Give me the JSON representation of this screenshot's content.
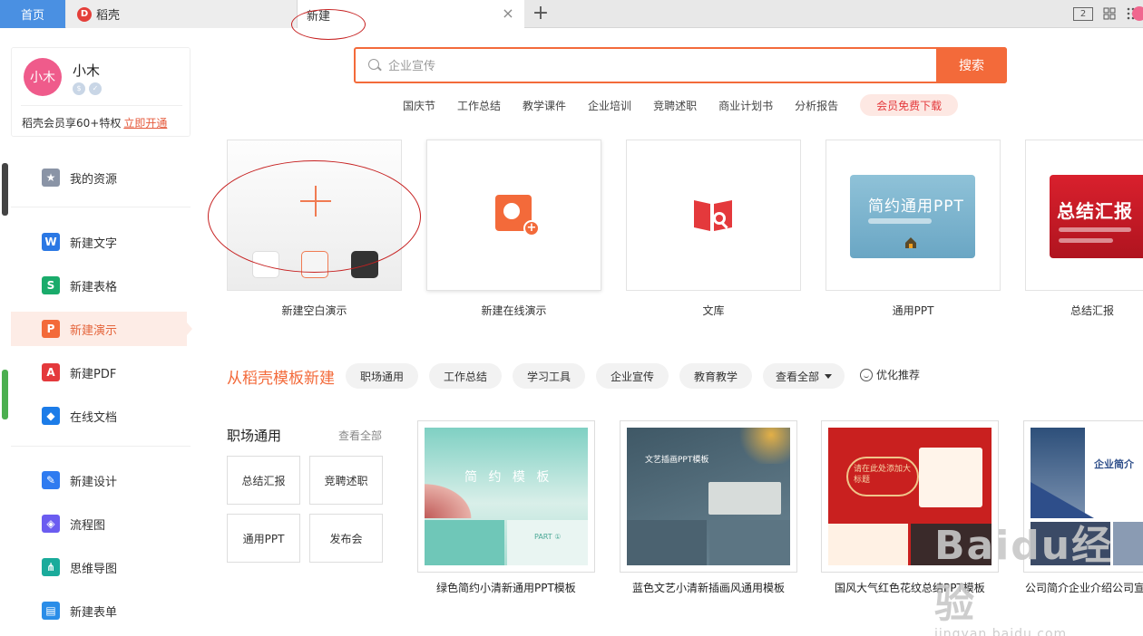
{
  "tabs": {
    "home": "首页",
    "daoke": "稻壳",
    "daoke_logo": "D",
    "new_tab": "新建",
    "close": "×",
    "add": "+",
    "window_badge": "2"
  },
  "user": {
    "avatar_text": "小木",
    "name": "小木",
    "vip_text": "稻壳会员享60+特权",
    "vip_link": "立即开通"
  },
  "sidebar": {
    "items": [
      {
        "label": "我的资源",
        "icon": "star-icon",
        "color": "#8a94a6"
      },
      {
        "label": "新建文字",
        "icon": "w-icon",
        "color": "#2b78e4"
      },
      {
        "label": "新建表格",
        "icon": "s-icon",
        "color": "#1aab6b"
      },
      {
        "label": "新建演示",
        "icon": "p-icon",
        "color": "#f36a3a"
      },
      {
        "label": "新建PDF",
        "icon": "pdf-icon",
        "color": "#e4393c"
      },
      {
        "label": "在线文档",
        "icon": "cloud-doc-icon",
        "color": "#1c7ce8"
      },
      {
        "label": "新建设计",
        "icon": "design-icon",
        "color": "#2f7bf0"
      },
      {
        "label": "流程图",
        "icon": "flow-icon",
        "color": "#6b5cf0"
      },
      {
        "label": "思维导图",
        "icon": "mindmap-icon",
        "color": "#1aab9b"
      },
      {
        "label": "新建表单",
        "icon": "form-icon",
        "color": "#2a8de8"
      }
    ]
  },
  "search": {
    "placeholder": "企业宣传",
    "button": "搜索",
    "hot_tags": [
      "国庆节",
      "工作总结",
      "教学课件",
      "企业培训",
      "竞聘述职",
      "商业计划书",
      "分析报告"
    ],
    "vip_download": "会员免费下载"
  },
  "create_cards": [
    {
      "label": "新建空白演示"
    },
    {
      "label": "新建在线演示"
    },
    {
      "label": "文库"
    },
    {
      "label": "通用PPT",
      "thumb_text": "简约通用PPT"
    },
    {
      "label": "总结汇报",
      "thumb_text": "总结汇报"
    }
  ],
  "templates": {
    "section_title": "从稻壳模板新建",
    "categories": [
      "职场通用",
      "工作总结",
      "学习工具",
      "企业宣传",
      "教育教学",
      "查看全部"
    ],
    "optimize": "优化推荐",
    "sub_title": "职场通用",
    "see_all": "查看全部",
    "small_cats": [
      "总结汇报",
      "竞聘述职",
      "通用PPT",
      "发布会"
    ],
    "items": [
      {
        "label": "绿色简约小清新通用PPT模板",
        "thumb_text": "简 约 模 板",
        "thumb_sub": "PART ①"
      },
      {
        "label": "蓝色文艺小清新插画风通用模板",
        "thumb_text": "文艺插画PPT模板"
      },
      {
        "label": "国风大气红色花纹总结PPT模板",
        "thumb_text": "请在此处添加大标题"
      },
      {
        "label": "公司简介企业介绍公司宣",
        "thumb_text": "企业简介"
      }
    ]
  },
  "watermark": {
    "main": "Baidu经验",
    "sub": "jingyan.baidu.com"
  }
}
